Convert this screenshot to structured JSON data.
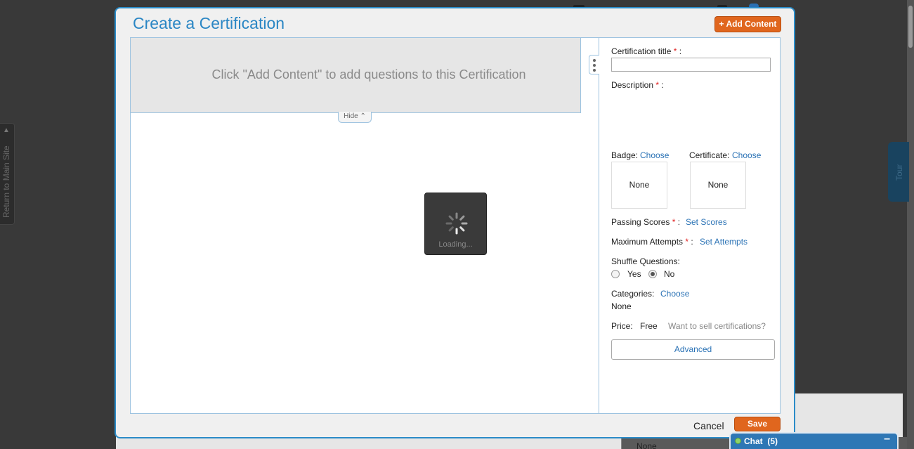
{
  "background": {
    "return_label": "Return to Main Site",
    "tour_label": "Tour",
    "under_value": "None"
  },
  "modal": {
    "title": "Create a Certification",
    "add_content_label": "+ Add Content",
    "empty_message": "Click \"Add Content\" to add questions to this Certification",
    "hide_label": "Hide",
    "hide_icon": "double-chevron-up-icon",
    "loading_text": "Loading...",
    "form": {
      "cert_title_label": "Certification title",
      "cert_title_value": "",
      "description_label": "Description",
      "required_mark": "*",
      "colon": ":",
      "badge_label": "Badge:",
      "badge_link": "Choose",
      "badge_value": "None",
      "certificate_label": "Certificate:",
      "certificate_link": "Choose",
      "certificate_value": "None",
      "passing_scores_label": "Passing Scores",
      "passing_scores_link": "Set Scores",
      "max_attempts_label": "Maximum Attempts",
      "max_attempts_link": "Set Attempts",
      "shuffle_label": "Shuffle Questions:",
      "shuffle_options": [
        "Yes",
        "No"
      ],
      "shuffle_selected": "No",
      "categories_label": "Categories:",
      "categories_link": "Choose",
      "categories_value": "None",
      "price_label": "Price:",
      "price_value": "Free",
      "sell_link": "Want to sell certifications?",
      "advanced_label": "Advanced"
    },
    "cancel_label": "Cancel",
    "save_label": "Save"
  },
  "chat": {
    "label": "Chat",
    "count": "(5)",
    "minimize_icon": "minus-icon"
  },
  "colors": {
    "accent_blue": "#2a86c4",
    "button_orange": "#e0661e",
    "link_blue": "#2a72b5",
    "required_red": "#e02020"
  }
}
